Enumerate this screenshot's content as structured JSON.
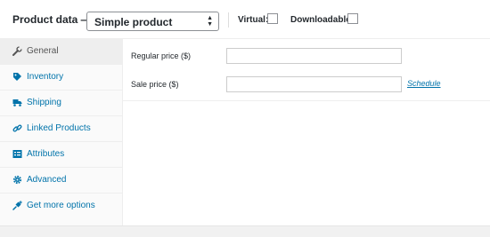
{
  "header": {
    "title": "Product data —",
    "product_type": {
      "selected": "Simple product",
      "arrow_icon": "up-down-arrows-icon"
    },
    "virtual_label": "Virtual:",
    "downloadable_label": "Downloadable:"
  },
  "tabs": [
    {
      "label": "General",
      "icon": "wrench-icon",
      "active": true
    },
    {
      "label": "Inventory",
      "icon": "tag-icon",
      "active": false
    },
    {
      "label": "Shipping",
      "icon": "truck-icon",
      "active": false
    },
    {
      "label": "Linked Products",
      "icon": "link-icon",
      "active": false
    },
    {
      "label": "Attributes",
      "icon": "list-icon",
      "active": false
    },
    {
      "label": "Advanced",
      "icon": "gear-icon",
      "active": false
    },
    {
      "label": "Get more options",
      "icon": "plugin-icon",
      "active": false
    }
  ],
  "fields": {
    "regular_price": {
      "label": "Regular price ($)",
      "value": ""
    },
    "sale_price": {
      "label": "Sale price ($)",
      "value": ""
    }
  },
  "schedule_link": "Schedule",
  "colors": {
    "link": "#0073aa",
    "active_tab_bg": "#eeeeee",
    "tab_bg": "#fafafa",
    "page_bg": "#f1f1f1"
  }
}
